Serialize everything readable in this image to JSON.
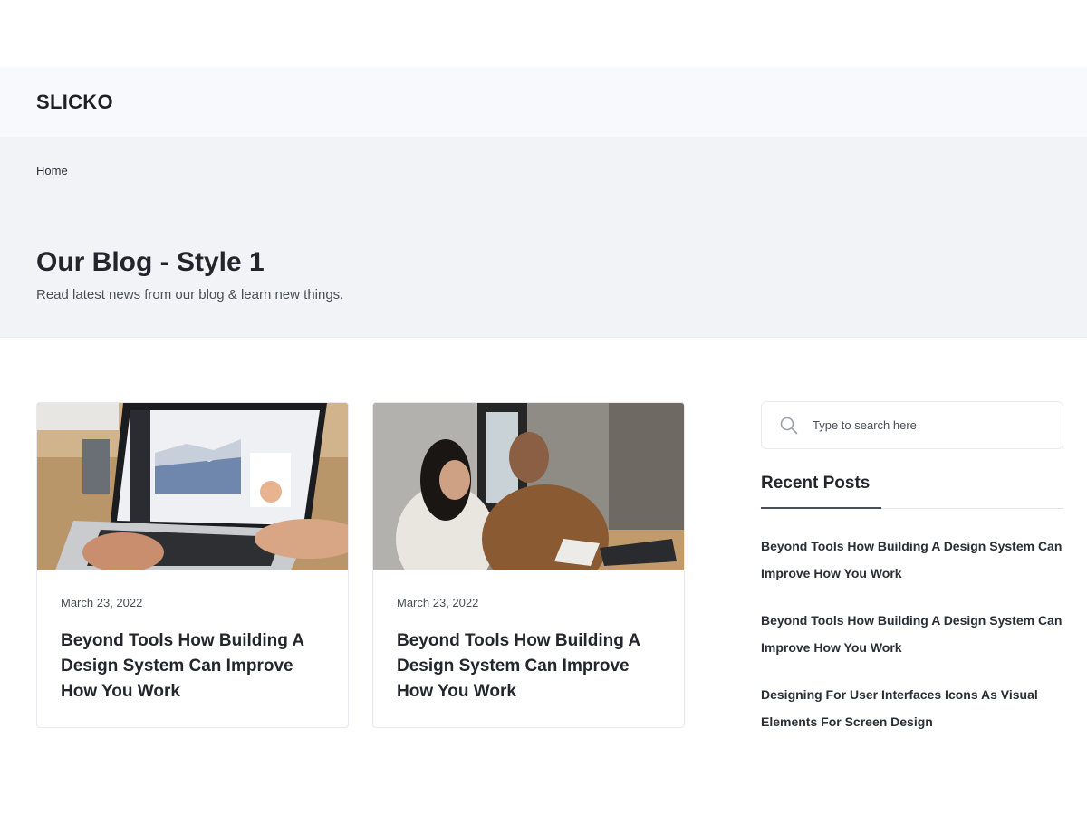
{
  "header": {
    "logo": "SLICKO"
  },
  "hero": {
    "breadcrumb": "Home",
    "title": "Our Blog - Style 1",
    "subtitle": "Read latest news from our blog & learn new things."
  },
  "posts": [
    {
      "date": "March 23, 2022",
      "title": "Beyond Tools How Building A Design System Can Improve How You Work",
      "image": "laptop-analytics-photo"
    },
    {
      "date": "March 23, 2022",
      "title": "Beyond Tools How Building A Design System Can Improve How You Work",
      "image": "team-meeting-photo"
    }
  ],
  "sidebar": {
    "search": {
      "placeholder": "Type to search here",
      "icon": "search-icon"
    },
    "recent_title": "Recent Posts",
    "recent_posts": [
      "Beyond Tools How Building A Design System Can Improve How You Work",
      "Beyond Tools How Building A Design System Can Improve How You Work",
      "Designing For User Interfaces Icons As Visual Elements For Screen Design"
    ]
  },
  "colors": {
    "header_bg": "#f8f9fc",
    "hero_bg": "#f2f3f7",
    "text": "#1f2329"
  }
}
